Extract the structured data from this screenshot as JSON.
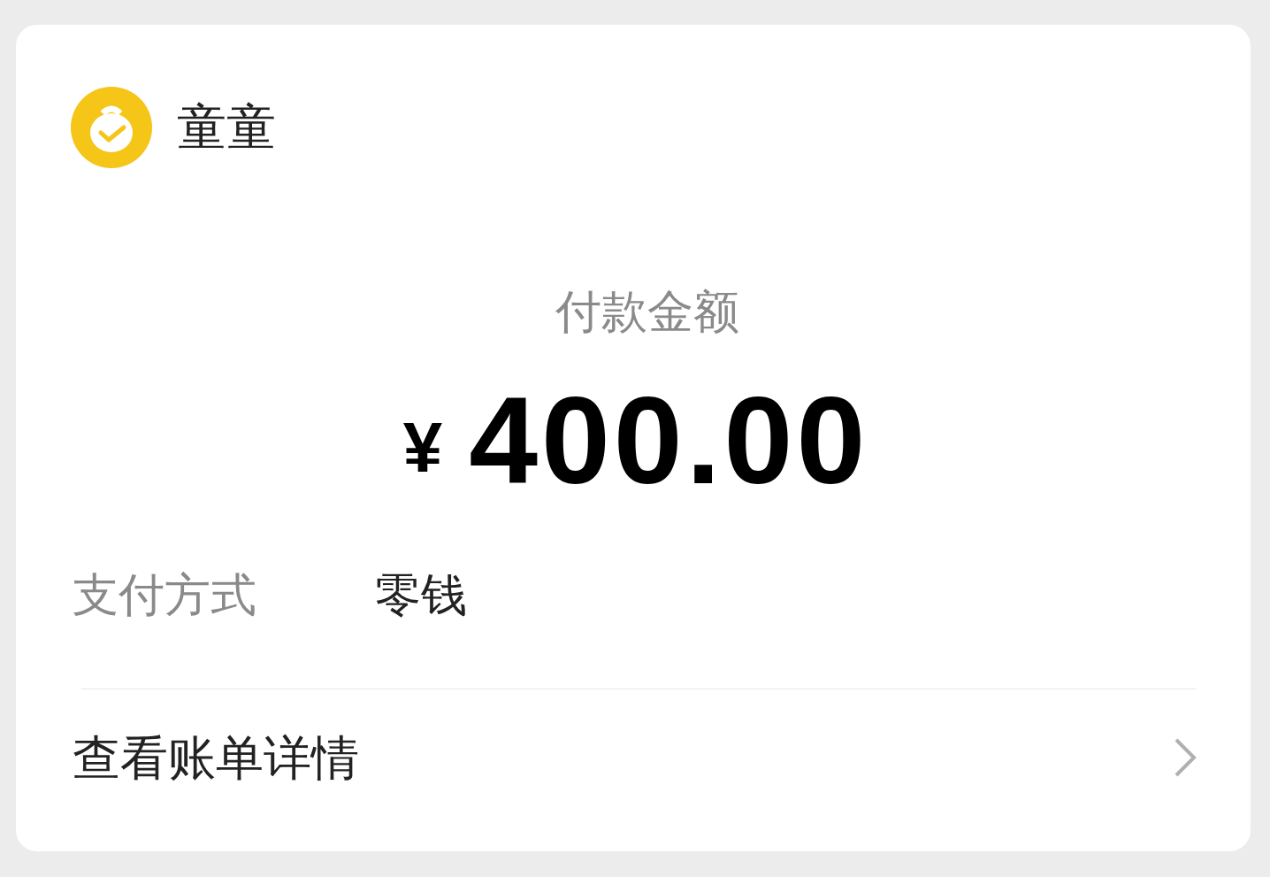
{
  "payee": {
    "name": "童童"
  },
  "amount": {
    "label": "付款金额",
    "currency": "¥",
    "value": "400.00"
  },
  "payment_method": {
    "label": "支付方式",
    "value": "零钱"
  },
  "bill_link": {
    "label": "查看账单详情"
  }
}
